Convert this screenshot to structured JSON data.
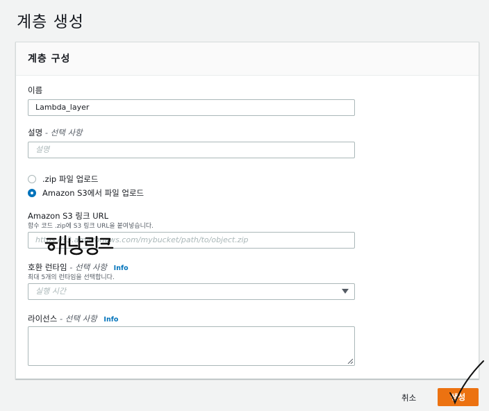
{
  "page": {
    "title": "계층 생성"
  },
  "panel": {
    "title": "계층 구성"
  },
  "name": {
    "label": "이름",
    "value": "Lambda_layer"
  },
  "description": {
    "label": "설명",
    "optional": "- 선택 사항",
    "placeholder": "설명"
  },
  "upload": {
    "options": [
      {
        "label": ".zip 파일 업로드",
        "checked": false
      },
      {
        "label": "Amazon S3에서 파일 업로드",
        "checked": true
      }
    ]
  },
  "s3_url": {
    "label": "Amazon S3 링크 URL",
    "description": "함수 코드 .zip에 S3 링크 URL을 붙여넣습니다.",
    "placeholder": "https://s3.amazonaws.com/mybucket/path/to/object.zip"
  },
  "runtime": {
    "label": "호환 런타임",
    "optional": "- 선택 사항",
    "info": "Info",
    "description": "최대 5개의 런타임을 선택합니다.",
    "placeholder": "실행 시간"
  },
  "license": {
    "label": "라이선스",
    "optional": "- 선택 사항",
    "info": "Info"
  },
  "footer": {
    "cancel": "취소",
    "create": "생성"
  },
  "annotations": {
    "handwritten_note": "해당링크"
  },
  "colors": {
    "accent": "#0073bb",
    "primary_button": "#ec7211"
  }
}
